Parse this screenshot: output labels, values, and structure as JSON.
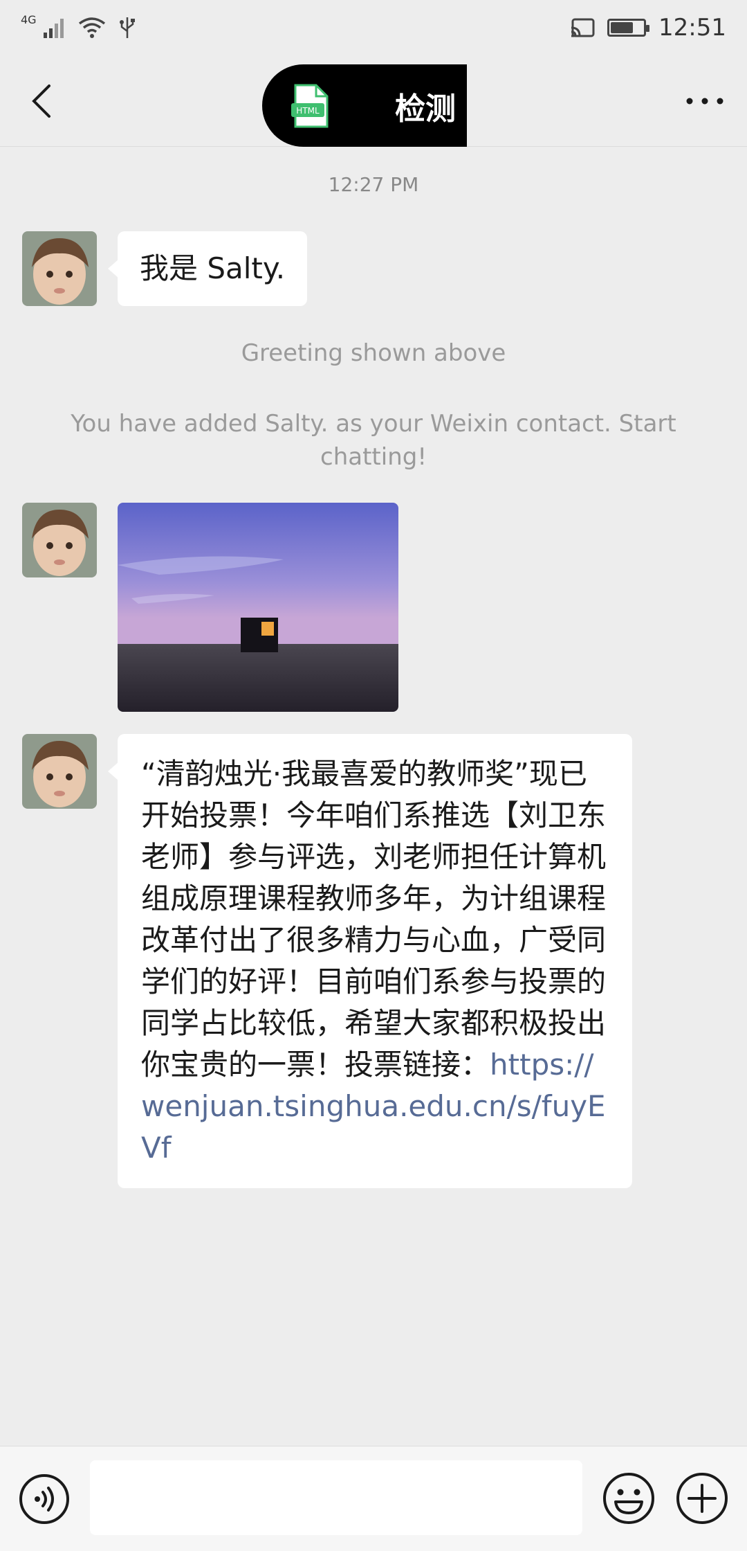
{
  "status_bar": {
    "network_type": "4G",
    "time": "12:51",
    "icons": [
      "signal-icon",
      "wifi-icon",
      "usb-icon",
      "cast-icon",
      "battery-icon"
    ]
  },
  "header": {
    "title": "检测",
    "file_label": "HTML",
    "icons": [
      "back-icon",
      "html-file-icon",
      "more-icon"
    ]
  },
  "chat": {
    "timestamp": "12:27 PM",
    "messages": [
      {
        "type": "text",
        "text": "我是 Salty."
      },
      {
        "type": "image"
      },
      {
        "type": "text",
        "text": "“清韵烛光·我最喜爱的教师奖”现已开始投票！今年咱们系推选【刘卫东老师】参与评选，刘老师担任计算机组成原理课程教师多年，为计组课程改革付出了很多精力与心血，广受同学们的好评！目前咱们系参与投票的同学占比较低，希望大家都积极投出你宝贵的一票！投票链接：",
        "link": "https://wenjuan.tsinghua.edu.cn/s/fuyEVf"
      }
    ],
    "system_notes": {
      "greeting": "Greeting shown above",
      "added": "You have added Salty. as your Weixin contact. Start chatting!"
    }
  },
  "input_bar": {
    "placeholder": "",
    "icons": [
      "voice-icon",
      "emoji-icon",
      "plus-icon"
    ]
  },
  "colors": {
    "background": "#ededed",
    "bubble": "#ffffff",
    "link": "#576b95",
    "system_text": "#9a9a9a",
    "html_icon_green": "#3fbf6f"
  }
}
